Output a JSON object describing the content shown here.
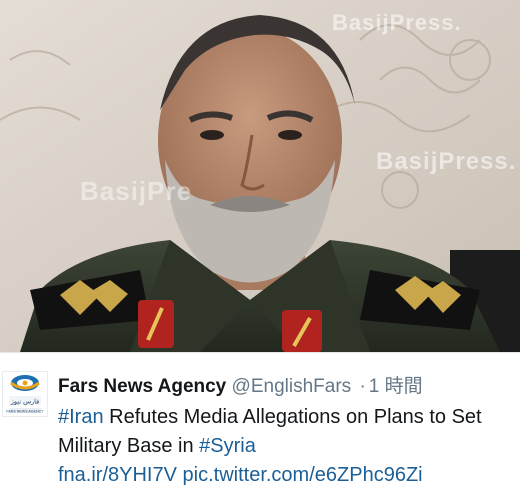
{
  "photo": {
    "watermarks": [
      "BasijPress.",
      "BasijPress.",
      "BasijPre"
    ]
  },
  "tweet": {
    "display_name": "Fars News Agency",
    "handle": "@EnglishFars",
    "separator": "·",
    "timestamp": "1 時間",
    "hashtag_1": "#Iran",
    "text_1": " Refutes Media Allegations on Plans to Set Military Base in ",
    "hashtag_2": "#Syria",
    "link_1": "fna.ir/8YHI7V",
    "link_2": "pic.twitter.com/e6ZPhc96Zi",
    "avatar_caption": "فارس نیوز",
    "avatar_subcaption": "FARS NEWS AGENCY",
    "avatar_icon": "fars-news-logo-icon"
  },
  "colors": {
    "link": "#1b5f96",
    "name": "#14171a",
    "meta": "#657786"
  }
}
